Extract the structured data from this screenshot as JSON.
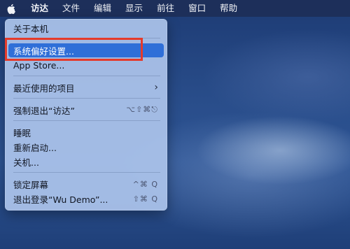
{
  "menubar": {
    "items": [
      {
        "label": "访达"
      },
      {
        "label": "文件"
      },
      {
        "label": "编辑"
      },
      {
        "label": "显示"
      },
      {
        "label": "前往"
      },
      {
        "label": "窗口"
      },
      {
        "label": "帮助"
      }
    ]
  },
  "apple_menu": {
    "about": "关于本机",
    "system_prefs": "系统偏好设置...",
    "app_store": "App Store...",
    "recent_items": "最近使用的项目",
    "force_quit": "强制退出“访达”",
    "force_quit_shortcut": "⌥⇧⌘⎋",
    "sleep": "睡眠",
    "restart": "重新启动...",
    "shutdown": "关机...",
    "lock_screen": "锁定屏幕",
    "lock_screen_shortcut": "^⌘ Q",
    "logout": "退出登录“Wu Demo”...",
    "logout_shortcut": "⇧⌘ Q"
  },
  "colors": {
    "highlight": "#2f6fd8",
    "annotation": "#e53a2a"
  }
}
